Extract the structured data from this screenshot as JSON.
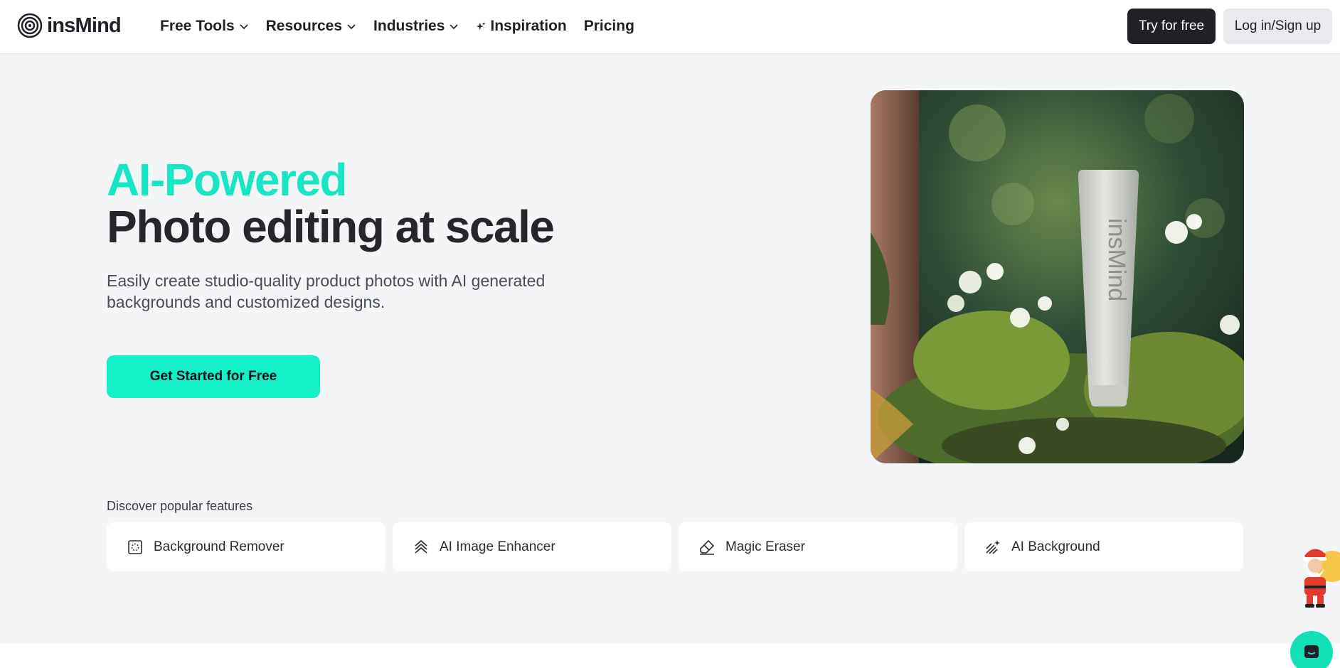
{
  "header": {
    "logo_text": "insMind",
    "nav": [
      {
        "label": "Free Tools",
        "has_dropdown": true
      },
      {
        "label": "Resources",
        "has_dropdown": true
      },
      {
        "label": "Industries",
        "has_dropdown": true
      },
      {
        "label": "Inspiration",
        "icon": "sparkle-icon"
      },
      {
        "label": "Pricing"
      }
    ],
    "try_label": "Try for free",
    "login_label": "Log in/Sign up"
  },
  "hero": {
    "accent": "AI-Powered",
    "title": "Photo editing at scale",
    "subtitle": "Easily create studio-quality product photos with AI generated backgrounds and customized designs.",
    "cta": "Get Started for Free",
    "product_label": "insMind"
  },
  "features": {
    "heading": "Discover popular features",
    "items": [
      {
        "label": "Background Remover",
        "icon": "background-remover-icon"
      },
      {
        "label": "AI Image Enhancer",
        "icon": "enhancer-icon"
      },
      {
        "label": "Magic Eraser",
        "icon": "eraser-icon"
      },
      {
        "label": "AI Background",
        "icon": "ai-background-icon"
      }
    ]
  },
  "colors": {
    "accent": "#17e6c4",
    "cta": "#14f0c8",
    "dark": "#1f2126",
    "bg": "#f4f5f7"
  }
}
